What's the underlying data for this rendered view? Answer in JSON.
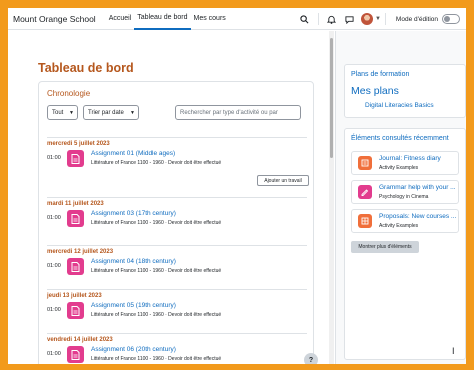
{
  "navbar": {
    "brand": "Mount Orange School",
    "links": [
      {
        "label": "Accueil",
        "active": false
      },
      {
        "label": "Tableau de bord",
        "active": true
      },
      {
        "label": "Mes cours",
        "active": false
      }
    ],
    "icons": [
      "search-icon",
      "bell-icon",
      "chat-icon",
      "user-avatar",
      "chevron-down-icon"
    ],
    "edit_mode_label": "Mode d'édition"
  },
  "page": {
    "title": "Tableau de bord"
  },
  "timeline": {
    "title": "Chronologie",
    "filter_label": "Tout",
    "sort_label": "Trier par date",
    "search_placeholder": "Rechercher par type d'activité ou par",
    "add_event_label": "Ajouter un travail",
    "days": [
      {
        "date": "mercredi 5 juillet 2023",
        "events": [
          {
            "time": "01:00",
            "name": "Assignment 01 (Middle ages)",
            "meta": "Littérature of France 1100 - 1960 · Devoir doit être effectué"
          }
        ]
      },
      {
        "date": "mardi 11 juillet 2023",
        "events": [
          {
            "time": "01:00",
            "name": "Assignment 03 (17th century)",
            "meta": "Littérature of France 1100 - 1960 · Devoir doit être effectué"
          }
        ]
      },
      {
        "date": "mercredi 12 juillet 2023",
        "events": [
          {
            "time": "01:00",
            "name": "Assignment 04 (18th century)",
            "meta": "Littérature of France 1100 - 1960 · Devoir doit être effectué"
          }
        ]
      },
      {
        "date": "jeudi 13 juillet 2023",
        "events": [
          {
            "time": "01:00",
            "name": "Assignment 05 (19th century)",
            "meta": "Littérature of France 1100 - 1960 · Devoir doit être effectué"
          }
        ]
      },
      {
        "date": "vendredi 14 juillet 2023",
        "events": [
          {
            "time": "01:00",
            "name": "Assignment 06 (20th century)",
            "meta": "Littérature of France 1100 - 1960 · Devoir doit être effectué"
          }
        ]
      }
    ]
  },
  "help_label": "?",
  "drawer": {
    "plans": {
      "title": "Plans de formation",
      "heading": "Mes plans",
      "link": "Digital Literacies Basics"
    },
    "recent": {
      "title": "Éléments consultés récemment",
      "items": [
        {
          "name": "Journal: Fitness diary",
          "sub": "Activity Examples",
          "color": "#f06f3b",
          "icon": "journal-icon"
        },
        {
          "name": "Grammar help with your ...",
          "sub": "Psychology in Cinema",
          "color": "#e23c8e",
          "icon": "assignment-icon"
        },
        {
          "name": "Proposals: New courses ...",
          "sub": "Activity Examples",
          "color": "#f06f3b",
          "icon": "database-icon"
        }
      ],
      "more_label": "Montrer plus d'éléments"
    }
  },
  "colors": {
    "accent": "#0f6cbf",
    "heading": "#b5571d",
    "background_border": "#f29a1c",
    "assignment": "#e23c8e"
  }
}
